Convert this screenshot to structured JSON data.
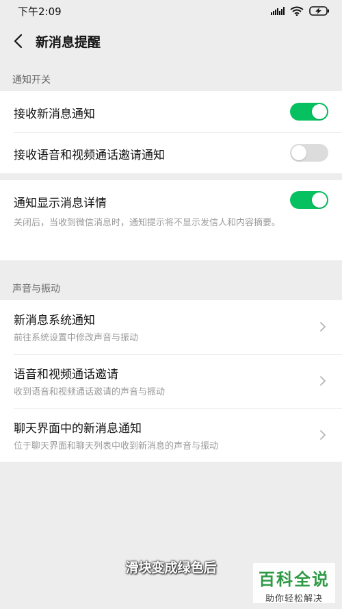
{
  "status": {
    "time": "下午2:09"
  },
  "nav": {
    "title": "新消息提醒"
  },
  "sections": {
    "notify_switch": "通知开关",
    "sound_vibrate": "声音与振动"
  },
  "notify": {
    "receive_new": {
      "label": "接收新消息通知",
      "on": true
    },
    "receive_call": {
      "label": "接收语音和视频通话邀请通知",
      "on": false
    }
  },
  "detail": {
    "label": "通知显示消息详情",
    "on": true,
    "description": "关闭后，当收到微信消息时，通知提示将不显示发信人和内容摘要。"
  },
  "sound_items": [
    {
      "title": "新消息系统通知",
      "subtitle": "前往系统设置中修改声音与振动"
    },
    {
      "title": "语音和视频通话邀请",
      "subtitle": "收到语音和视频通话邀请的声音与振动"
    },
    {
      "title": "聊天界面中的新消息通知",
      "subtitle": "位于聊天界面和聊天列表中收到新消息的声音与振动"
    }
  ],
  "caption": "滑块变成绿色后",
  "watermark": {
    "title": "百科全说",
    "subtitle": "助你轻松解决"
  },
  "colors": {
    "accent": "#07c160",
    "background": "#ededed",
    "watermark_green": "#2e9a45"
  }
}
